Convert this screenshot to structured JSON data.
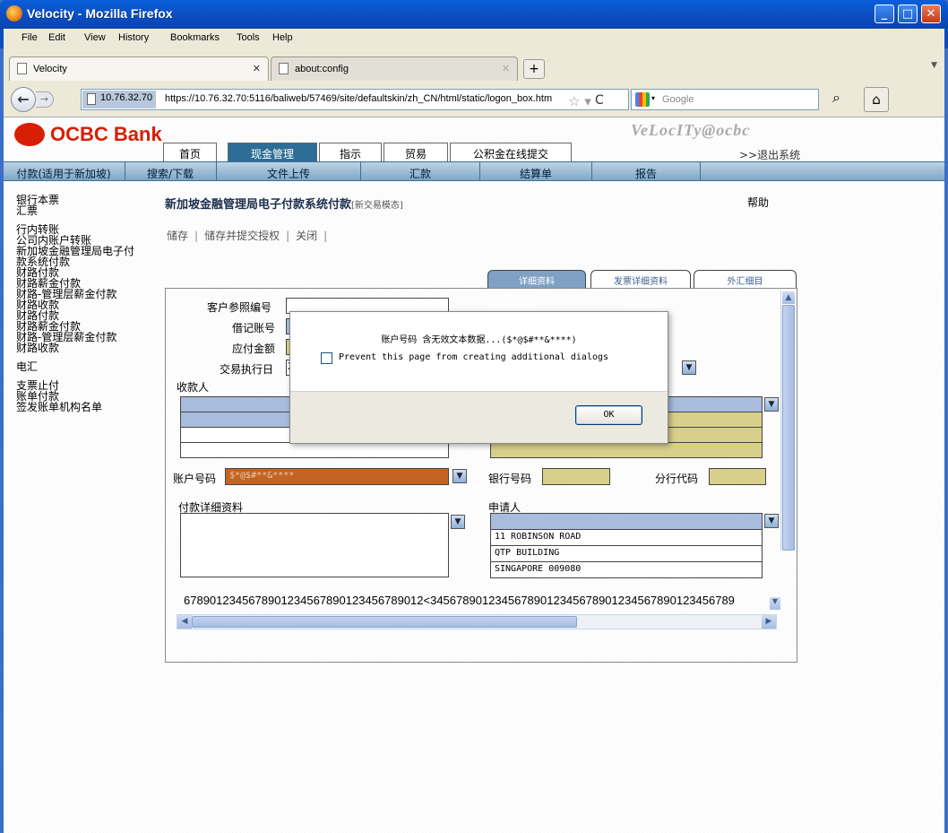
{
  "window": {
    "title": "Velocity - Mozilla Firefox"
  },
  "menu": [
    "File",
    "Edit",
    "View",
    "History",
    "Bookmarks",
    "Tools",
    "Help"
  ],
  "tabs": [
    {
      "label": "Velocity",
      "active": true
    },
    {
      "label": "about:config",
      "active": false
    }
  ],
  "nav": {
    "identity": "10.76.32.70",
    "url": "https://10.76.32.70:5116/baliweb/57469/site/defaultskin/zh_CN/html/static/logon_box.htm",
    "search_placeholder": "Google"
  },
  "header": {
    "brand": "OCBC Bank",
    "velocity": "VeLocITy@ocbc",
    "main_tabs": [
      "首页",
      "现金管理",
      "指示",
      "贸易",
      "公积金在线提交"
    ],
    "logout": ">>退出系统",
    "subnav": [
      "付款(适用于新加坡)",
      "搜索/下载",
      "文件上传",
      "汇款",
      "结算单",
      "报告"
    ]
  },
  "sidebar": {
    "groups": [
      [
        "银行本票",
        "汇票"
      ],
      [
        "行内转账",
        "公司内账户转账",
        "新加坡金融管理局电子付",
        "款系统付款",
        "财路付款",
        "财路薪金付款",
        "财路-管理层薪金付款",
        "财路收款",
        "财路付款",
        "财路薪金付款",
        "财路-管理层薪金付款",
        "财路收款"
      ],
      [
        "电汇"
      ],
      [
        "支票止付",
        "账单付款",
        "签发账单机构名单"
      ]
    ]
  },
  "page": {
    "title": "新加坡金融管理局电子付款系统付款",
    "title_note": "[新交易模态]",
    "help": "帮助",
    "actions": [
      "储存",
      "储存并提交授权",
      "关闭"
    ],
    "detail_tabs": [
      "详细资料",
      "发票详细资料",
      "外汇细目"
    ]
  },
  "form": {
    "customer_ref_label": "客户参照编号",
    "debit_account_label": "借记账号",
    "amount_label": "应付金额",
    "exec_date_label": "交易执行日",
    "exec_date_value": "2",
    "payee_label": "收款人",
    "account_no_label": "账户号码",
    "account_no_value": "$*@$#**&****",
    "bank_code_label": "银行号码",
    "branch_code_label": "分行代码",
    "payment_details_label": "付款详细资料",
    "applicant_label": "申请人",
    "applicant_lines": [
      "11 ROBINSON ROAD",
      "QTP BUILDING",
      "SINGAPORE 009080"
    ],
    "long_text": "6789012345678901234567890123456789012<34567890123456789012345678901234567890123456789"
  },
  "dialog": {
    "message": "账户号码 含无效文本数据...($*@$#**&****)",
    "checkbox_label": "Prevent this page from creating additional dialogs",
    "ok_label": "OK"
  },
  "colors": {
    "titlebar": "#0b4cc0",
    "accent": "#2e6d96",
    "brand": "#d81e05"
  }
}
